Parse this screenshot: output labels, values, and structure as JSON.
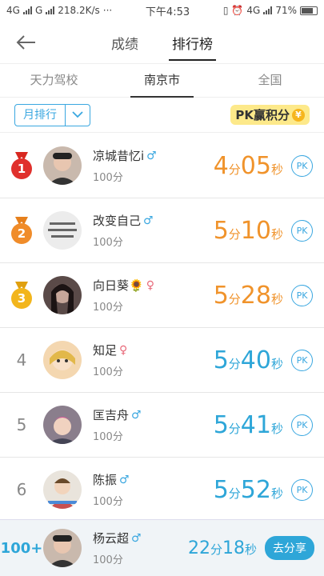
{
  "status_bar": {
    "left": "4G",
    "left2": "G",
    "speed": "218.2K/s",
    "dots": "···",
    "time": "下午4:53",
    "network": "4G",
    "battery": "71%"
  },
  "nav": {
    "tabs": [
      "成绩",
      "排行榜"
    ],
    "active": 1
  },
  "region_tabs": [
    "天力驾校",
    "南京市",
    "全国"
  ],
  "filter": {
    "dropdown_label": "月排行",
    "banner_text": "PK赢积分",
    "coin_symbol": "¥"
  },
  "colors": {
    "accent": "#2ea6d8",
    "orange": "#f0932b",
    "medal_gold": "#f2b51c",
    "medal_silver": "#f08c2a",
    "medal_red": "#e0302c"
  },
  "rows": [
    {
      "rank": "1",
      "name": "凉城昔忆i",
      "gender": "♂",
      "gender_type": "male",
      "score": "100分",
      "min": "4",
      "min_unit": "分",
      "sec": "05",
      "sec_unit": "秒",
      "pk": "PK"
    },
    {
      "rank": "2",
      "name": "改变自己",
      "gender": "♂",
      "gender_type": "male",
      "score": "100分",
      "min": "5",
      "min_unit": "分",
      "sec": "10",
      "sec_unit": "秒",
      "pk": "PK"
    },
    {
      "rank": "3",
      "name": "向日葵🌻",
      "gender": "♀",
      "gender_type": "female",
      "score": "100分",
      "min": "5",
      "min_unit": "分",
      "sec": "28",
      "sec_unit": "秒",
      "pk": "PK"
    },
    {
      "rank": "4",
      "name": "知足",
      "gender": "♀",
      "gender_type": "female",
      "score": "100分",
      "min": "5",
      "min_unit": "分",
      "sec": "40",
      "sec_unit": "秒",
      "pk": "PK"
    },
    {
      "rank": "5",
      "name": "匡吉舟",
      "gender": "♂",
      "gender_type": "male",
      "score": "100分",
      "min": "5",
      "min_unit": "分",
      "sec": "41",
      "sec_unit": "秒",
      "pk": "PK"
    },
    {
      "rank": "6",
      "name": "陈振",
      "gender": "♂",
      "gender_type": "male",
      "score": "100分",
      "min": "5",
      "min_unit": "分",
      "sec": "52",
      "sec_unit": "秒",
      "pk": "PK"
    }
  ],
  "me": {
    "rank": "100+",
    "name": "杨云超",
    "gender": "♂",
    "score": "100分",
    "min": "22",
    "min_unit": "分",
    "sec": "18",
    "sec_unit": "秒",
    "share": "去分享"
  }
}
